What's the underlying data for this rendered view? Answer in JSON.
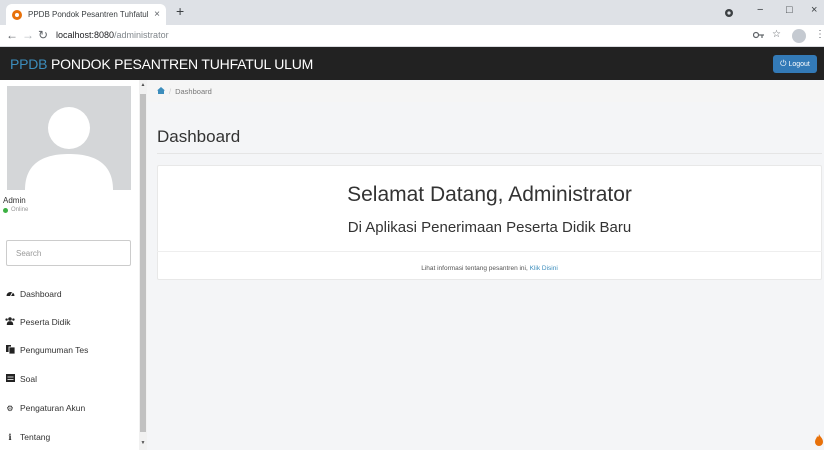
{
  "browser": {
    "tab_title": "PPDB Pondok Pesantren Tuhfatul",
    "tab_close": "×",
    "new_tab": "+",
    "url_host": "localhost:8080",
    "url_path": "/administrator",
    "controls": {
      "minimize": "−",
      "maximize": "□",
      "close": "×"
    }
  },
  "navbar": {
    "brand_accent": "PPDB",
    "brand_rest": " PONDOK PESANTREN TUHFATUL ULUM",
    "logout_label": "Logout"
  },
  "sidebar": {
    "user_name": "Admin",
    "status": "Online",
    "search_placeholder": "Search",
    "menu": [
      {
        "label": "Dashboard",
        "icon": "dashboard-icon"
      },
      {
        "label": "Peserta Didik",
        "icon": "users-icon"
      },
      {
        "label": "Pengumuman Tes",
        "icon": "copy-icon"
      },
      {
        "label": "Soal",
        "icon": "list-icon"
      },
      {
        "label": "Pengaturan Akun",
        "icon": "cogs-icon"
      },
      {
        "label": "Tentang",
        "icon": "info-icon"
      }
    ]
  },
  "breadcrumb": {
    "current": "Dashboard"
  },
  "main": {
    "page_title": "Dashboard",
    "welcome": "Selamat Datang, Administrator",
    "subtitle": "Di Aplikasi Penerimaan Peserta Didik Baru",
    "info_text": "Lihat informasi tentang pesantren ini, ",
    "info_link": "Klik Disini"
  },
  "colors": {
    "navbar_bg": "#222222",
    "brand_accent": "#3c8dbc",
    "logout_button": "#337ab7",
    "online_dot": "#3cb043"
  }
}
